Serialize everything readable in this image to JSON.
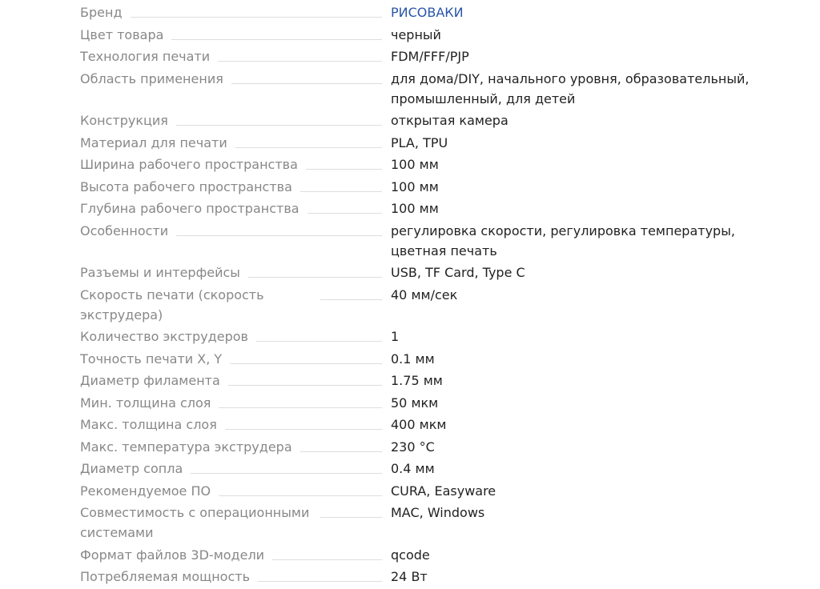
{
  "specs": [
    {
      "label": "Бренд",
      "value": "РИСОВАКИ",
      "link": true
    },
    {
      "label": "Цвет товара",
      "value": "черный"
    },
    {
      "label": "Технология печати",
      "value": "FDM/FFF/PJP"
    },
    {
      "label": "Область применения",
      "value": "для дома/DIY, начального уровня, образовательный, промышленный, для детей"
    },
    {
      "label": "Конструкция",
      "value": "открытая камера"
    },
    {
      "label": "Материал для печати",
      "value": "PLA, TPU"
    },
    {
      "label": "Ширина рабочего пространства",
      "value": "100 мм"
    },
    {
      "label": "Высота рабочего пространства",
      "value": "100 мм"
    },
    {
      "label": "Глубина рабочего пространства",
      "value": "100 мм"
    },
    {
      "label": "Особенности",
      "value": "регулировка скорости, регулировка температуры, цветная печать"
    },
    {
      "label": "Разъемы и интерфейсы",
      "value": "USB, TF Card, Type C"
    },
    {
      "label": "Скорость печати (скорость экструдера)",
      "value": "40 мм/сек"
    },
    {
      "label": "Количество экструдеров",
      "value": "1"
    },
    {
      "label": "Точность печати X, Y",
      "value": "0.1 мм"
    },
    {
      "label": "Диаметр филамента",
      "value": "1.75 мм"
    },
    {
      "label": "Мин. толщина слоя",
      "value": "50 мкм"
    },
    {
      "label": "Макс. толщина слоя",
      "value": "400 мкм"
    },
    {
      "label": "Макс. температура экструдера",
      "value": "230 °C"
    },
    {
      "label": "Диаметр сопла",
      "value": "0.4 мм"
    },
    {
      "label": "Рекомендуемое ПО",
      "value": "CURA, Easyware"
    },
    {
      "label": "Совместимость с операционными системами",
      "value": "MAC, Windows"
    },
    {
      "label": "Формат файлов 3D-модели",
      "value": "qcode"
    },
    {
      "label": "Потребляемая мощность",
      "value": "24 Вт"
    }
  ],
  "colors": {
    "label": "#888888",
    "value": "#222222",
    "brand_link": "#2a55a8",
    "leader_line": "#dedede"
  }
}
